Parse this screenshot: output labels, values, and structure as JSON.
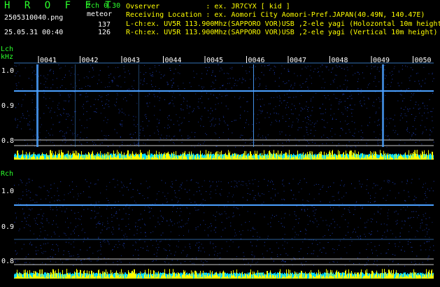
{
  "header": {
    "logo": "H R O F F T",
    "channel_version": "2ch 0.30",
    "mode": "meteor",
    "file_name": "2505310040.png",
    "datetime": "25.05.31 00:40",
    "count_l": "137",
    "count_r": "126",
    "observer": "Ovserver           : ex. JR7CYX [ kid ]",
    "location": "Receiving Location : ex. Aomori City Aomori-Pref.JAPAN(40.49N, 140.47E)",
    "lch_info": "L-ch:ex. UV5R 113.900Mhz(SAPPORO VOR)USB ,2-ele yagi (Holozontal 10m height",
    "rch_info": "R-ch:ex. UV5R 113.900Mhz(SAPPORO VOR)USB ,2-ele yagi (Vertical 10m height)"
  },
  "panels": {
    "lch": {
      "title": "Lch",
      "unit": "kHz",
      "y_ticks": [
        "1.0",
        "0.9",
        "0.8"
      ],
      "time_labels": [
        "0041",
        "0042",
        "0043",
        "0044",
        "0045",
        "0046",
        "0047",
        "0048",
        "0049",
        "0050"
      ]
    },
    "rch": {
      "title": "Rch",
      "y_ticks": [
        "1.0",
        "0.9",
        "0.8"
      ]
    }
  },
  "colors": {
    "background": "#000000",
    "text_green": "#2bff2b",
    "text_yellow": "#ffff00",
    "signal_line": "#4aa0ff",
    "axis_line": "#ffffff",
    "noise_cyan": "#00d8ff",
    "noise_yellow": "#ffff00"
  }
}
